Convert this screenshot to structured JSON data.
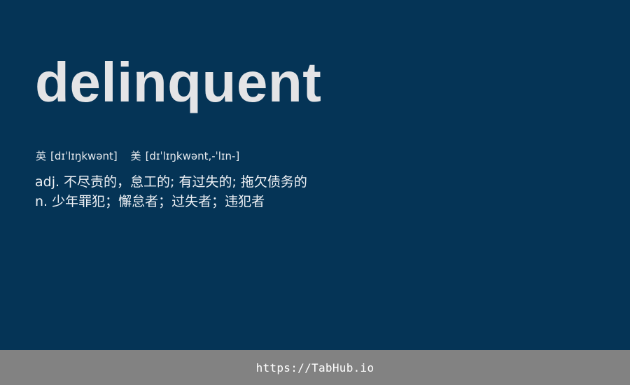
{
  "entry": {
    "word": "delinquent",
    "phonetics": {
      "uk": {
        "label": "英",
        "ipa": "[dɪˈlɪŋkwənt]"
      },
      "us": {
        "label": "美",
        "ipa": "[dɪˈlɪŋkwənt,-ˈlɪn-]"
      }
    },
    "definitions": [
      {
        "pos": "adj.",
        "meaning": "不尽责的，怠工的; 有过失的; 拖欠债务的"
      },
      {
        "pos": "n.",
        "meaning": "少年罪犯；懈怠者；过失者；违犯者"
      }
    ]
  },
  "footer": {
    "link_text": "https://TabHub.io"
  },
  "colors": {
    "background": "#053456",
    "footer_background": "#828282",
    "text": "#e4e4e6"
  }
}
